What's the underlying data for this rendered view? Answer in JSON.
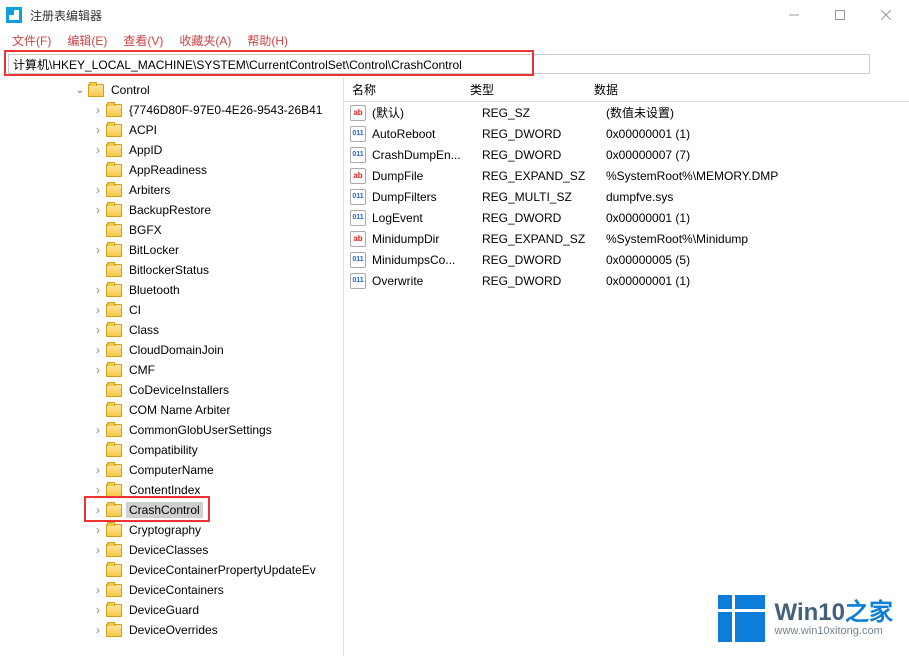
{
  "window": {
    "title": "注册表编辑器"
  },
  "menu": {
    "file": "文件(F)",
    "edit": "编辑(E)",
    "view": "查看(V)",
    "favorites": "收藏夹(A)",
    "help": "帮助(H)"
  },
  "address": {
    "path": "计算机\\HKEY_LOCAL_MACHINE\\SYSTEM\\CurrentControlSet\\Control\\CrashControl"
  },
  "tree": {
    "root_label": "Control",
    "items": [
      {
        "label": "{7746D80F-97E0-4E26-9543-26B41",
        "exp": "collapsed",
        "indent": 1
      },
      {
        "label": "ACPI",
        "exp": "collapsed",
        "indent": 1
      },
      {
        "label": "AppID",
        "exp": "collapsed",
        "indent": 1
      },
      {
        "label": "AppReadiness",
        "exp": "none",
        "indent": 1
      },
      {
        "label": "Arbiters",
        "exp": "collapsed",
        "indent": 1
      },
      {
        "label": "BackupRestore",
        "exp": "collapsed",
        "indent": 1
      },
      {
        "label": "BGFX",
        "exp": "none",
        "indent": 1
      },
      {
        "label": "BitLocker",
        "exp": "collapsed",
        "indent": 1
      },
      {
        "label": "BitlockerStatus",
        "exp": "none",
        "indent": 1
      },
      {
        "label": "Bluetooth",
        "exp": "collapsed",
        "indent": 1
      },
      {
        "label": "CI",
        "exp": "collapsed",
        "indent": 1
      },
      {
        "label": "Class",
        "exp": "collapsed",
        "indent": 1
      },
      {
        "label": "CloudDomainJoin",
        "exp": "collapsed",
        "indent": 1
      },
      {
        "label": "CMF",
        "exp": "collapsed",
        "indent": 1
      },
      {
        "label": "CoDeviceInstallers",
        "exp": "none",
        "indent": 1
      },
      {
        "label": "COM Name Arbiter",
        "exp": "none",
        "indent": 1
      },
      {
        "label": "CommonGlobUserSettings",
        "exp": "collapsed",
        "indent": 1
      },
      {
        "label": "Compatibility",
        "exp": "none",
        "indent": 1
      },
      {
        "label": "ComputerName",
        "exp": "collapsed",
        "indent": 1
      },
      {
        "label": "ContentIndex",
        "exp": "collapsed",
        "indent": 1
      },
      {
        "label": "CrashControl",
        "exp": "collapsed",
        "indent": 1,
        "selected": true
      },
      {
        "label": "Cryptography",
        "exp": "collapsed",
        "indent": 1
      },
      {
        "label": "DeviceClasses",
        "exp": "collapsed",
        "indent": 1
      },
      {
        "label": "DeviceContainerPropertyUpdateEv",
        "exp": "none",
        "indent": 1
      },
      {
        "label": "DeviceContainers",
        "exp": "collapsed",
        "indent": 1
      },
      {
        "label": "DeviceGuard",
        "exp": "collapsed",
        "indent": 1
      },
      {
        "label": "DeviceOverrides",
        "exp": "collapsed",
        "indent": 1
      }
    ]
  },
  "values": {
    "headers": {
      "name": "名称",
      "type": "类型",
      "data": "数据"
    },
    "rows": [
      {
        "icon": "sz",
        "name": "(默认)",
        "type": "REG_SZ",
        "data": "(数值未设置)"
      },
      {
        "icon": "dw",
        "name": "AutoReboot",
        "type": "REG_DWORD",
        "data": "0x00000001 (1)"
      },
      {
        "icon": "dw",
        "name": "CrashDumpEn...",
        "type": "REG_DWORD",
        "data": "0x00000007 (7)"
      },
      {
        "icon": "sz",
        "name": "DumpFile",
        "type": "REG_EXPAND_SZ",
        "data": "%SystemRoot%\\MEMORY.DMP"
      },
      {
        "icon": "dw",
        "name": "DumpFilters",
        "type": "REG_MULTI_SZ",
        "data": "dumpfve.sys"
      },
      {
        "icon": "dw",
        "name": "LogEvent",
        "type": "REG_DWORD",
        "data": "0x00000001 (1)"
      },
      {
        "icon": "sz",
        "name": "MinidumpDir",
        "type": "REG_EXPAND_SZ",
        "data": "%SystemRoot%\\Minidump"
      },
      {
        "icon": "dw",
        "name": "MinidumpsCo...",
        "type": "REG_DWORD",
        "data": "0x00000005 (5)"
      },
      {
        "icon": "dw",
        "name": "Overwrite",
        "type": "REG_DWORD",
        "data": "0x00000001 (1)"
      }
    ]
  },
  "watermark": {
    "brand1": "Win10",
    "brand2": "之家",
    "url": "www.win10xitong.com"
  }
}
